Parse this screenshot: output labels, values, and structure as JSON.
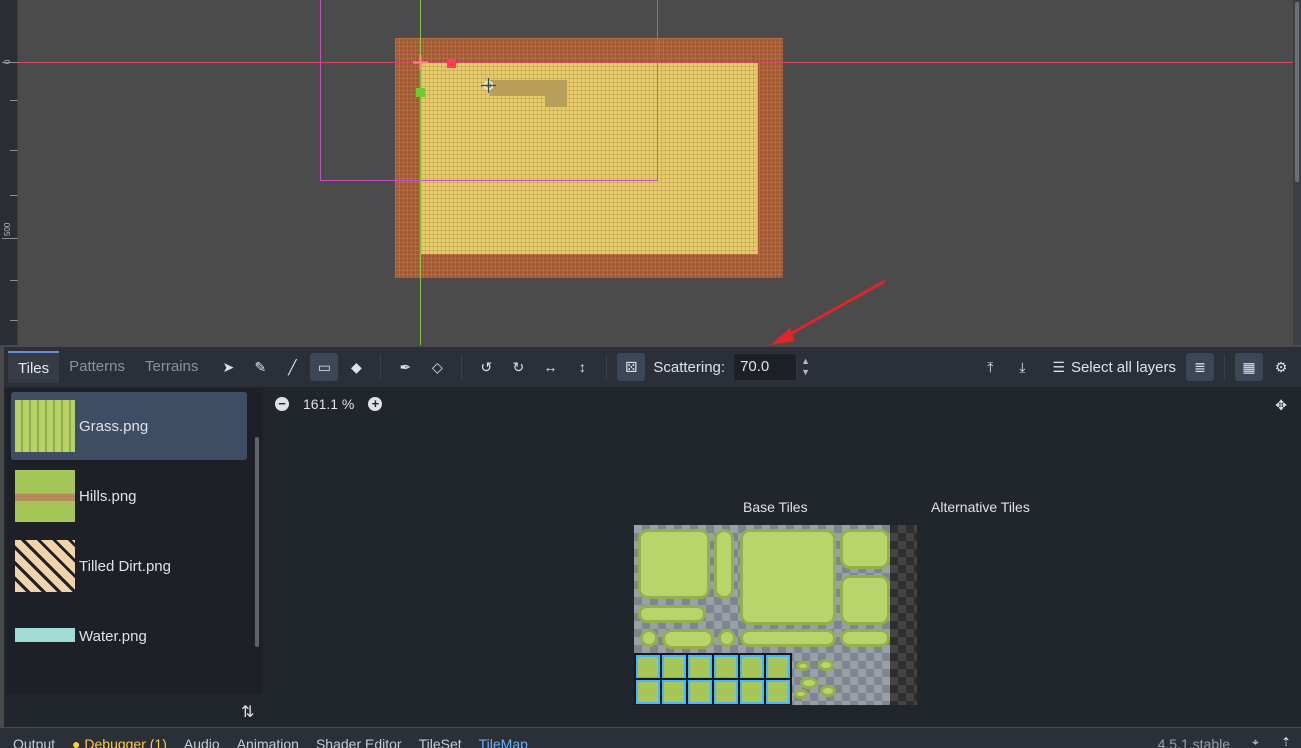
{
  "viewport": {
    "ruler_labels": [
      "0",
      "500"
    ]
  },
  "tileset_editor": {
    "tabs": [
      {
        "label": "Tiles",
        "active": true
      },
      {
        "label": "Patterns",
        "active": false
      },
      {
        "label": "Terrains",
        "active": false
      }
    ],
    "tools": [
      "select-icon",
      "paint-icon",
      "line-icon",
      "rect-icon",
      "bucket-icon",
      "picker-icon",
      "eraser-icon",
      "rotate-left-icon",
      "rotate-right-icon",
      "flip-h-icon",
      "flip-v-icon",
      "random-tile-icon"
    ],
    "scattering_label": "Scattering:",
    "scattering_value": "70.0",
    "select_layers_label": "Select all layers"
  },
  "sources": [
    {
      "label": "Grass.png",
      "selected": true
    },
    {
      "label": "Hills.png",
      "selected": false
    },
    {
      "label": "Tilled Dirt.png",
      "selected": false
    },
    {
      "label": "Water.png",
      "selected": false
    }
  ],
  "atlas": {
    "zoom": "161.1 %",
    "base_label": "Base Tiles",
    "alt_label": "Alternative Tiles",
    "accent": "#48b6ff"
  },
  "bottom_bar": {
    "tabs": [
      {
        "label": "Output",
        "state": "normal"
      },
      {
        "label": "Debugger (1)",
        "state": "warn"
      },
      {
        "label": "Audio",
        "state": "normal"
      },
      {
        "label": "Animation",
        "state": "normal"
      },
      {
        "label": "Shader Editor",
        "state": "normal"
      },
      {
        "label": "TileSet",
        "state": "normal"
      },
      {
        "label": "TileMap",
        "state": "active"
      }
    ],
    "version": "4.5.1.stable"
  }
}
